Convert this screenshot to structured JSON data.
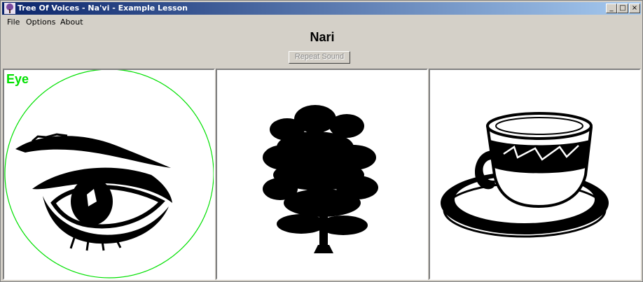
{
  "window": {
    "title": "Tree Of Voices - Na'vi - Example Lesson"
  },
  "menu": {
    "file": "File",
    "options": "Options",
    "about": "About"
  },
  "lesson": {
    "word": "Nari",
    "repeat_label": "Repeat Sound"
  },
  "choices": [
    {
      "icon": "eye-image",
      "label": "Eye",
      "selected": true
    },
    {
      "icon": "tree-image"
    },
    {
      "icon": "teacup-image"
    }
  ],
  "colors": {
    "selection": "#00e000",
    "titlebar_start": "#0a246a",
    "titlebar_end": "#a6caf0"
  }
}
